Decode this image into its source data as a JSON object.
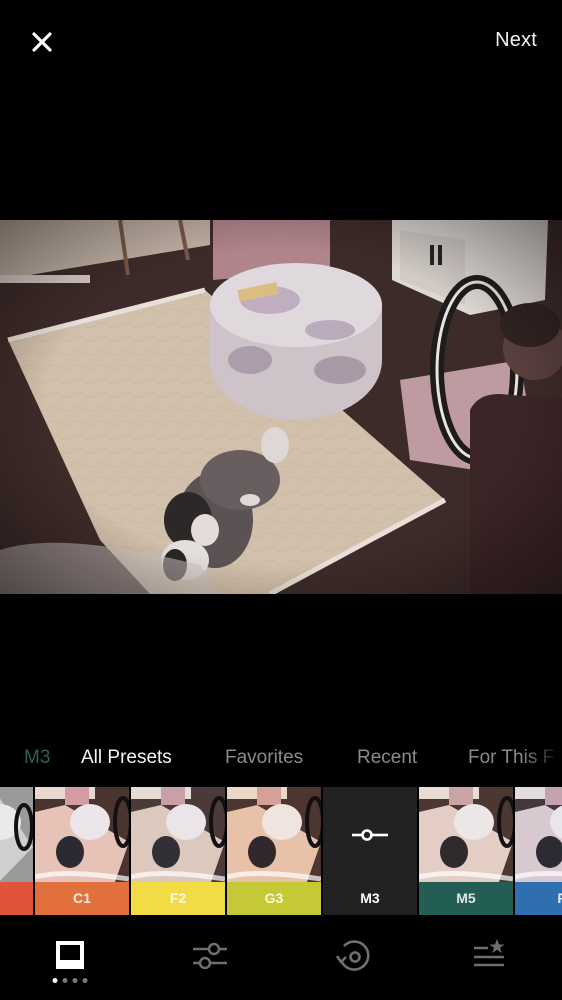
{
  "topbar": {
    "close_icon": "close-icon",
    "next_label": "Next"
  },
  "photo": {
    "description": "Dog lying on a beige rug next to a floral ottoman, person with ring light on right"
  },
  "tabs": {
    "current_preset": "M3",
    "items": [
      {
        "label": "All Presets",
        "active": true
      },
      {
        "label": "Favorites",
        "active": false
      },
      {
        "label": "Recent",
        "active": false
      },
      {
        "label": "For This F",
        "active": false
      }
    ]
  },
  "presets": [
    {
      "name": "",
      "color": "#e0553a",
      "selected": false
    },
    {
      "name": "C1",
      "color": "#e2703d",
      "selected": false
    },
    {
      "name": "F2",
      "color": "#f2dc45",
      "selected": false
    },
    {
      "name": "G3",
      "color": "#c5c935",
      "selected": false
    },
    {
      "name": "M3",
      "color": "#222222",
      "selected": true,
      "icon": "slider-adjust-icon"
    },
    {
      "name": "M5",
      "color": "#235e55",
      "selected": false
    },
    {
      "name": "P",
      "color": "#2f6fb0",
      "selected": false
    }
  ],
  "bottom_nav": {
    "items": [
      {
        "name": "presets",
        "icon": "presets-frame-icon",
        "active": true,
        "page_dots": 4,
        "active_dot": 1
      },
      {
        "name": "tools",
        "icon": "sliders-icon",
        "active": false
      },
      {
        "name": "history",
        "icon": "history-icon",
        "active": false
      },
      {
        "name": "recipes",
        "icon": "recipes-list-star-icon",
        "active": false
      }
    ]
  },
  "colors": {
    "background": "#000000",
    "active_text": "#f4f4f4",
    "inactive_text": "#8a8a8a",
    "current_preset_text": "#2f5f58",
    "nav_inactive": "#6f6f6f"
  }
}
